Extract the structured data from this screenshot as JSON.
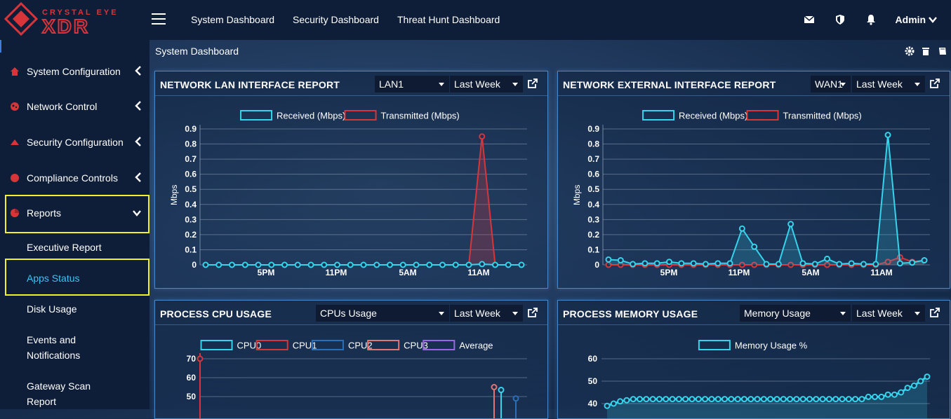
{
  "brand": {
    "small": "CRYSTAL EYE",
    "large": "XDR"
  },
  "nav": {
    "links": [
      "System Dashboard",
      "Security Dashboard",
      "Threat Hunt Dashboard"
    ],
    "user": "Admin"
  },
  "sidebar": {
    "items": [
      {
        "label": "System Configuration",
        "icon": "gear-icon"
      },
      {
        "label": "Network Control",
        "icon": "network-icon"
      },
      {
        "label": "Security Configuration",
        "icon": "shield-icon"
      },
      {
        "label": "Compliance Controls",
        "icon": "compliance-icon"
      },
      {
        "label": "Reports",
        "icon": "chart-icon"
      }
    ],
    "subitems": [
      "Executive Report",
      "Apps Status",
      "Disk Usage",
      "Events and",
      "Notifications",
      "Gateway Scan",
      "Report"
    ]
  },
  "page": {
    "title": "System Dashboard"
  },
  "colors": {
    "received": "#35d3ec",
    "transmitted": "#d8353a",
    "accent": "#4a89c9",
    "highlight": "#f4ef2c",
    "link_active": "#3ec3f2"
  },
  "panels": {
    "lan": {
      "title": "NETWORK LAN INTERFACE REPORT",
      "select1": "LAN1",
      "select2": "Last Week"
    },
    "ext": {
      "title": "NETWORK EXTERNAL INTERFACE REPORT",
      "select1": "WAN1",
      "select2": "Last Week"
    },
    "cpu": {
      "title": "PROCESS CPU USAGE",
      "select1": "CPUs Usage",
      "select2": "Last Week"
    },
    "mem": {
      "title": "PROCESS MEMORY USAGE",
      "select1": "Memory Usage",
      "select2": "Last Week"
    }
  },
  "chart_data": [
    {
      "type": "line",
      "ylabel": "Mbps",
      "ylim": [
        0,
        0.9
      ],
      "yticks": [
        "0",
        "0.1",
        "0.2",
        "0.3",
        "0.4",
        "0.5",
        "0.6",
        "0.7",
        "0.8",
        "0.9"
      ],
      "xticks": [
        "5PM",
        "11PM",
        "5AM",
        "11AM"
      ],
      "series": [
        {
          "name": "Received (Mbps)",
          "values": [
            0,
            0,
            0,
            0,
            0,
            0,
            0,
            0,
            0,
            0,
            0,
            0,
            0,
            0,
            0,
            0,
            0,
            0,
            0,
            0,
            0,
            0.005,
            0,
            0,
            0
          ]
        },
        {
          "name": "Transmitted (Mbps)",
          "values": [
            0,
            0,
            0,
            0,
            0,
            0,
            0,
            0,
            0,
            0,
            0,
            0,
            0,
            0,
            0,
            0,
            0,
            0,
            0,
            0,
            0,
            0.85,
            0,
            0,
            0
          ]
        }
      ]
    },
    {
      "type": "line",
      "ylabel": "Mbps",
      "ylim": [
        0,
        0.9
      ],
      "yticks": [
        "0",
        "0.1",
        "0.2",
        "0.3",
        "0.4",
        "0.5",
        "0.6",
        "0.7",
        "0.8",
        "0.9"
      ],
      "xticks": [
        "5PM",
        "11PM",
        "5AM",
        "11AM"
      ],
      "series": [
        {
          "name": "Received (Mbps)",
          "values": [
            0.035,
            0.03,
            0.005,
            0.01,
            0.01,
            0.02,
            0.01,
            0.01,
            0.005,
            0.01,
            0.01,
            0.24,
            0.12,
            0.005,
            0.005,
            0.27,
            0.01,
            0.005,
            0.04,
            0.005,
            0.01,
            0.005,
            0.005,
            0.86,
            0.01,
            0.015,
            0.03
          ]
        },
        {
          "name": "Transmitted (Mbps)",
          "values": [
            0,
            0,
            0,
            0,
            0,
            0,
            0,
            0,
            0,
            0,
            0,
            0,
            0,
            0,
            0,
            0,
            0,
            0,
            0,
            0,
            0,
            0,
            0,
            0.02,
            0.05,
            0.02,
            0.03
          ]
        }
      ]
    },
    {
      "type": "line",
      "ylim": [
        40,
        70
      ],
      "yticks": [
        "50",
        "60",
        "70"
      ],
      "series": [
        {
          "name": "CPU0",
          "values": []
        },
        {
          "name": "CPU1",
          "values": [
            70
          ]
        },
        {
          "name": "CPU2",
          "values": []
        },
        {
          "name": "CPU3",
          "values": [
            55
          ]
        },
        {
          "name": "Average",
          "values": []
        }
      ]
    },
    {
      "type": "line",
      "ylim": [
        40,
        60
      ],
      "yticks": [
        "40",
        "50",
        "60"
      ],
      "series": [
        {
          "name": "Memory Usage %",
          "values": [
            39,
            40,
            41,
            41.5,
            42,
            42,
            42,
            42,
            42,
            42,
            42,
            42,
            42,
            42,
            42,
            42,
            42,
            42,
            42,
            42,
            42,
            42,
            42,
            42,
            42,
            42,
            42,
            42,
            42,
            42,
            42,
            42,
            42,
            42,
            42,
            42,
            42,
            42,
            42,
            42,
            43,
            43,
            43,
            44,
            44,
            45,
            47,
            48,
            50,
            52
          ]
        }
      ]
    }
  ]
}
